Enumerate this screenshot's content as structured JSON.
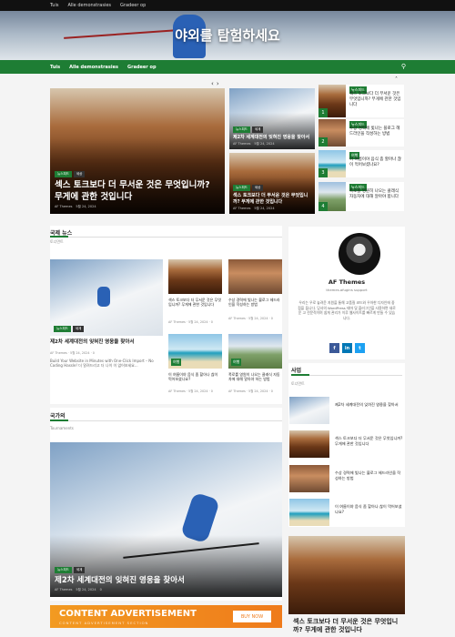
{
  "topbar": {
    "links": [
      "Tuis",
      "Alle demonstrasies",
      "Gradeer op"
    ]
  },
  "hero": {
    "title": "야외를 탐험하세요"
  },
  "nav": {
    "items": [
      "Tuis",
      "Alle demonstrasies",
      "Gradeer op"
    ]
  },
  "slider": {
    "main": {
      "tags": [
        "뉴스피드",
        "세상"
      ],
      "title": "섹스 토크보다 더 무서운 것은 무엇입니까? 무게에 관한 것입니다",
      "author": "AF Themes",
      "date": "5월 24, 2024"
    },
    "card2": {
      "tags": [
        "뉴스피드",
        "세계"
      ],
      "title": "제2차 세계대전의 잊혀진 영웅을 찾아서",
      "author": "AF Themes",
      "date": "5월 24, 2024"
    },
    "card3": {
      "tags": [
        "뉴스피드",
        "세상"
      ],
      "title": "섹스 토크보다 더 무서운 것은 무엇입니까? 무게에 관한 것입니다",
      "author": "AF Themes",
      "date": "5월 24, 2024"
    }
  },
  "trending": [
    {
      "num": "1",
      "tag": "뉴스피드",
      "title": "섹스 토크보다 더 무서운 것은 무엇입니까? 무게에 관한 것입니다"
    },
    {
      "num": "2",
      "tag": "뉴스피드",
      "title": "수상 경력에 빛나는 블로그 헤드라인을 작성하는 방법"
    },
    {
      "num": "3",
      "tag": "여행",
      "title": "이 여름이야 음식 좀 할아나 찮이 먹어보셨나요?"
    },
    {
      "num": "4",
      "tag": "뉴스피드",
      "title": "폭로를 영원히 나오는 클래식 자동차에 대해 알아야 합니다"
    }
  ],
  "intl": {
    "title": "국제 뉴스",
    "sub": "토너먼트",
    "main": {
      "tags": [
        "뉴스피드",
        "세계"
      ],
      "title": "제2차 세계대전의 잊혀진 영웅을 찾아서",
      "author": "AF Themes",
      "date": "5월 24, 2024",
      "comments": "0",
      "excerpt": "Build Your Website in Minutes with One-Click Import – No Coding Hassle! 더 알려드리고 더 나이 이 없어보세요..."
    },
    "grid": [
      {
        "title": "섹스 토크보다 더 무서운 것은 무엇입니까? 무게에 관한 것입니다",
        "author": "AF Themes",
        "date": "5월 24, 2024",
        "comments": "0"
      },
      {
        "title": "수상 경력에 빛나는 블로그 헤드라인을 작성하는 방법",
        "author": "AF Themes",
        "date": "5월 24, 2024",
        "comments": "0"
      },
      {
        "badge": "여행",
        "title": "이 여름이야 음식 좀 할아나 찮이 먹어보셨나요?",
        "author": "AF Themes",
        "date": "5월 24, 2024",
        "comments": "0"
      },
      {
        "badge": "여행",
        "title": "폭로를 영원히 나오는 클래식 자동차에 대해 알아야 하는 방법",
        "author": "AF Themes",
        "date": "5월 24, 2024",
        "comments": "0"
      }
    ]
  },
  "country": {
    "title": "국가의",
    "sub": "Tournaments",
    "main": {
      "tags": [
        "뉴스피드",
        "세계"
      ],
      "title": "제2차 세계대전의 잊혀진 영웅을 찾아서",
      "author": "AF Themes",
      "date": "5월 24, 2024",
      "comments": "0"
    }
  },
  "ad": {
    "heading": "CONTENT ADVERTISEMENT",
    "sub": "CONTENT ADVERTISEMENT SECTION",
    "button": "BUY NOW"
  },
  "author_widget": {
    "name": "AF Themes",
    "handle": "themes.afugins support",
    "bio": "우리는 우로 놓려운 지원을 통해 고품질 코드와 우아한 디자인에 중점을 둡니다. 당사의 WordPress 테마 및 플러그인을 사용하면 새로운 고 전문적이며 쉽게 관리가 이루 웹사이트를 빠르게 만들 수 있습니다."
  },
  "social": [
    "f",
    "in",
    "t"
  ],
  "sidebar": {
    "title": "사업",
    "sub": "토너먼트",
    "items": [
      "제2차 세계대전의 잊혀진 영웅을 찾아서",
      "섹스 토크보다 더 무서운 것은 무엇입니까? 무게에 관한 것입니다",
      "수상 경력에 빛나는 블로그 헤드라인을 작성하는 방법",
      "이 여름이야 음식 좀 할아나 찮이 먹어보셨나요?"
    ],
    "featured": {
      "title": "섹스 토크보다 더 무서운 것은 무엇입니까? 무게에 관한 것입니다"
    }
  },
  "icons": {
    "search": "search-icon",
    "prev": "chevron-left-icon",
    "next": "chevron-right-icon"
  }
}
